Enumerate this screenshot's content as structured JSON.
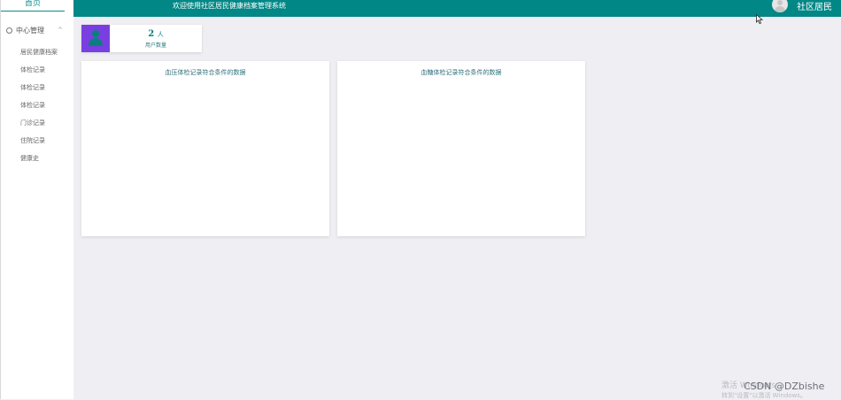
{
  "sidebar": {
    "home_tab": "首页",
    "menu_parent": "中心管理",
    "items": [
      {
        "label": "居民健康档案"
      },
      {
        "label": "体检记录"
      },
      {
        "label": "体检记录"
      },
      {
        "label": "体检记录"
      },
      {
        "label": "门诊记录"
      },
      {
        "label": "住院记录"
      },
      {
        "label": "健康史"
      }
    ]
  },
  "header": {
    "title": "欢迎使用社区居民健康档案管理系统",
    "user_name": "社区居民",
    "bg_color": "#008786"
  },
  "stat_card": {
    "value": "2",
    "unit": "人",
    "label": "用户数量",
    "icon": "user-icon",
    "icon_bg": "#7a3fe0"
  },
  "panels": [
    {
      "title": "血压体检记录符合条件的数据"
    },
    {
      "title": "血糖体检记录符合条件的数据"
    }
  ],
  "watermark": {
    "activate_title": "激活 Windows",
    "activate_sub": "转到\"设置\"以激活 Windows。",
    "csdn": "CSDN @DZbishe"
  }
}
